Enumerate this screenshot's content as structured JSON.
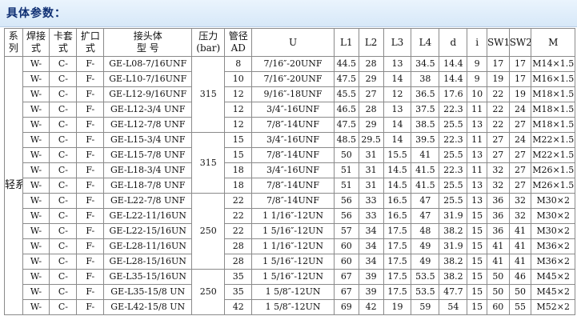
{
  "page": {
    "title": "具体参数："
  },
  "table": {
    "headers": {
      "series": [
        "系",
        "列"
      ],
      "weld": [
        "焊接",
        "式"
      ],
      "ferrule": [
        "卡套",
        "式"
      ],
      "flare": [
        "扩口",
        "式"
      ],
      "model": [
        "接头体",
        "型 号"
      ],
      "pressure": [
        "压力",
        "(bar)"
      ],
      "diameter": [
        "管径",
        "AD"
      ],
      "u": "U",
      "l1": "L1",
      "l2": "L2",
      "l3": "L3",
      "l4": "L4",
      "d": "d",
      "i": "i",
      "sw1": "SW1",
      "sw2": "SW2",
      "m": "M"
    },
    "series_label": "轻系列L",
    "pressure_groups": [
      "315",
      "315",
      "250",
      "250"
    ],
    "rows": [
      {
        "weld": "W-",
        "ferrule": "C-",
        "flare": "F-",
        "model": "GE-L08-7/16UNF",
        "ad": "8",
        "u": "7/16″-20UNF",
        "l1": "44.5",
        "l2": "28",
        "l3": "13",
        "l4": "34.5",
        "d": "14.4",
        "i": "9",
        "sw1": "17",
        "sw2": "17",
        "m": "M14×1.5"
      },
      {
        "weld": "W-",
        "ferrule": "C-",
        "flare": "F-",
        "model": "GE-L10-7/16UNF",
        "ad": "10",
        "u": "7/16″-20UNF",
        "l1": "47.5",
        "l2": "29",
        "l3": "14",
        "l4": "38",
        "d": "14.4",
        "i": "9",
        "sw1": "19",
        "sw2": "17",
        "m": "M16×1.5"
      },
      {
        "weld": "W-",
        "ferrule": "C-",
        "flare": "F-",
        "model": "GE-L12-9/16UNF",
        "ad": "12",
        "u": "9/16″-18UNF",
        "l1": "45.5",
        "l2": "27",
        "l3": "12",
        "l4": "36.5",
        "d": "17.6",
        "i": "10",
        "sw1": "22",
        "sw2": "19",
        "m": "M18×1.5"
      },
      {
        "weld": "W-",
        "ferrule": "C-",
        "flare": "F-",
        "model": "GE-L12-3/4 UNF",
        "ad": "12",
        "u": "3/4″-16UNF",
        "l1": "46.5",
        "l2": "28",
        "l3": "13",
        "l4": "37.5",
        "d": "22.3",
        "i": "11",
        "sw1": "22",
        "sw2": "24",
        "m": "M18×1.5"
      },
      {
        "weld": "W-",
        "ferrule": "C-",
        "flare": "F-",
        "model": "GE-L12-7/8 UNF",
        "ad": "12",
        "u": "7/8″-14UNF",
        "l1": "47.5",
        "l2": "29",
        "l3": "14",
        "l4": "38.5",
        "d": "25.5",
        "i": "13",
        "sw1": "22",
        "sw2": "27",
        "m": "M18×1.5"
      },
      {
        "weld": "W-",
        "ferrule": "C-",
        "flare": "F-",
        "model": "GE-L15-3/4 UNF",
        "ad": "15",
        "u": "3/4″-16UNF",
        "l1": "48.5",
        "l2": "29.5",
        "l3": "14",
        "l4": "39.5",
        "d": "22.3",
        "i": "11",
        "sw1": "27",
        "sw2": "24",
        "m": "M22×1.5"
      },
      {
        "weld": "W-",
        "ferrule": "C-",
        "flare": "F-",
        "model": "GE-L15-7/8 UNF",
        "ad": "15",
        "u": "7/8″-14UNF",
        "l1": "50",
        "l2": "31",
        "l3": "15.5",
        "l4": "41",
        "d": "25.5",
        "i": "13",
        "sw1": "27",
        "sw2": "27",
        "m": "M22×1.5"
      },
      {
        "weld": "W-",
        "ferrule": "C-",
        "flare": "F-",
        "model": "GE-L18-3/4 UNF",
        "ad": "18",
        "u": "3/4″-16UNF",
        "l1": "51",
        "l2": "31",
        "l3": "14.5",
        "l4": "41.5",
        "d": "22.3",
        "i": "11",
        "sw1": "32",
        "sw2": "27",
        "m": "M26×1.5"
      },
      {
        "weld": "W-",
        "ferrule": "C-",
        "flare": "F-",
        "model": "GE-L18-7/8 UNF",
        "ad": "18",
        "u": "7/8″-14UNF",
        "l1": "51",
        "l2": "31",
        "l3": "14.5",
        "l4": "41.5",
        "d": "25.5",
        "i": "13",
        "sw1": "32",
        "sw2": "27",
        "m": "M26×1.5"
      },
      {
        "weld": "W-",
        "ferrule": "C-",
        "flare": "F-",
        "model": "GE-L22-7/8 UNF",
        "ad": "22",
        "u": "7/8″-14UNF",
        "l1": "56",
        "l2": "33",
        "l3": "16.5",
        "l4": "47",
        "d": "25.5",
        "i": "13",
        "sw1": "36",
        "sw2": "32",
        "m": "M30×2"
      },
      {
        "weld": "W-",
        "ferrule": "C-",
        "flare": "F-",
        "model": "GE-L22-11/16UN",
        "ad": "22",
        "u": "1 1/16″-12UN",
        "l1": "56",
        "l2": "33",
        "l3": "16.5",
        "l4": "47",
        "d": "31.9",
        "i": "15",
        "sw1": "36",
        "sw2": "32",
        "m": "M30×2"
      },
      {
        "weld": "W-",
        "ferrule": "C-",
        "flare": "F-",
        "model": "GE-L22-15/16UN",
        "ad": "22",
        "u": "1 5/16″-12UN",
        "l1": "57",
        "l2": "34",
        "l3": "17.5",
        "l4": "48",
        "d": "38.2",
        "i": "15",
        "sw1": "36",
        "sw2": "41",
        "m": "M30×2"
      },
      {
        "weld": "W-",
        "ferrule": "C-",
        "flare": "F-",
        "model": "GE-L28-11/16UN",
        "ad": "28",
        "u": "1 1/16″-12UN",
        "l1": "60",
        "l2": "34",
        "l3": "17.5",
        "l4": "49",
        "d": "31.9",
        "i": "15",
        "sw1": "41",
        "sw2": "41",
        "m": "M36×2"
      },
      {
        "weld": "W-",
        "ferrule": "C-",
        "flare": "F-",
        "model": "GE-L28-15/16UN",
        "ad": "28",
        "u": "1 5/16″-12UN",
        "l1": "60",
        "l2": "34",
        "l3": "17.5",
        "l4": "49",
        "d": "38.2",
        "i": "15",
        "sw1": "41",
        "sw2": "41",
        "m": "M36×2"
      },
      {
        "weld": "W-",
        "ferrule": "C-",
        "flare": "F-",
        "model": "GE-L35-15/16UN",
        "ad": "35",
        "u": "1 5/16″-12UN",
        "l1": "67",
        "l2": "39",
        "l3": "17.5",
        "l4": "53.5",
        "d": "38.2",
        "i": "15",
        "sw1": "50",
        "sw2": "46",
        "m": "M45×2"
      },
      {
        "weld": "W-",
        "ferrule": "C-",
        "flare": "F-",
        "model": "GE-L35-15/8 UN",
        "ad": "35",
        "u": "1 5/8″-12UN",
        "l1": "67",
        "l2": "39",
        "l3": "17.5",
        "l4": "53.5",
        "d": "47.7",
        "i": "15",
        "sw1": "50",
        "sw2": "50",
        "m": "M45×2"
      },
      {
        "weld": "W-",
        "ferrule": "C-",
        "flare": "F-",
        "model": "GE-L42-15/8 UN",
        "ad": "42",
        "u": "1 5/8″-12UN",
        "l1": "69",
        "l2": "42",
        "l3": "19",
        "l4": "59",
        "d": "54",
        "i": "15",
        "sw1": "60",
        "sw2": "55",
        "m": "M52×2"
      }
    ]
  }
}
